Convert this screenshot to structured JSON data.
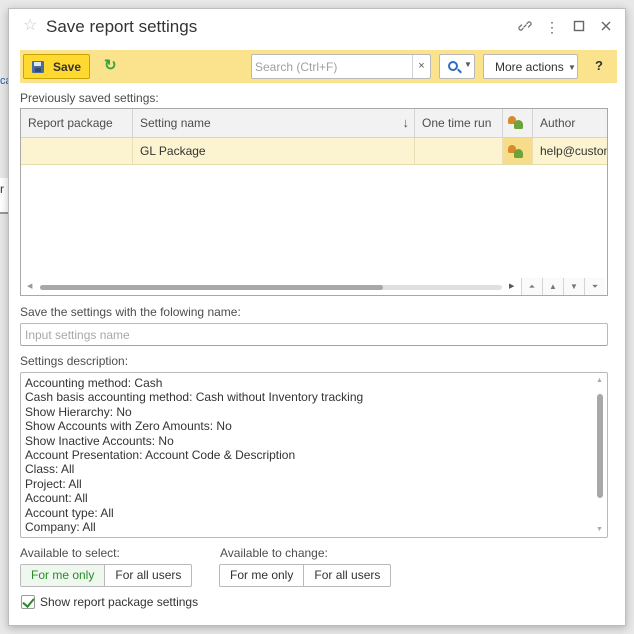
{
  "background": {
    "fragment_a": "ca",
    "fragment_b": "r"
  },
  "window": {
    "title": "Save report settings",
    "icons": [
      "star-icon",
      "link-icon",
      "more-vertical-icon",
      "maximize-icon",
      "close-icon"
    ]
  },
  "toolbar": {
    "save_label": "Save",
    "search_placeholder": "Search (Ctrl+F)",
    "search_clear": "×",
    "more_actions_label": "More actions",
    "help_label": "?"
  },
  "previously_saved": {
    "label": "Previously saved settings:",
    "columns": [
      "Report package",
      "Setting name",
      "One time run",
      "",
      "Author"
    ],
    "sort_indicator": "↓",
    "rows": [
      {
        "report_package": "",
        "setting_name": "GL Package",
        "one_time_run": "",
        "author": "help@customer"
      }
    ]
  },
  "name_field": {
    "label": "Save the settings with the folowing name:",
    "placeholder": "Input settings name",
    "value": ""
  },
  "description": {
    "label": "Settings description:",
    "lines": [
      "Accounting method: Cash",
      "Cash basis accounting method: Cash without Inventory tracking",
      "Show Hierarchy: No",
      "Show Accounts with Zero Amounts: No",
      "Show Inactive Accounts: No",
      "Account Presentation: Account Code & Description",
      "Class:  All",
      "Project:  All",
      "Account:  All",
      "Account type:  All",
      "Company:  All"
    ]
  },
  "available_to_select": {
    "label": "Available to select:",
    "options": [
      "For me only",
      "For all users"
    ],
    "selected": "For me only"
  },
  "available_to_change": {
    "label": "Available to change:",
    "options": [
      "For me only",
      "For all users"
    ]
  },
  "show_package": {
    "label": "Show report package settings",
    "checked": true
  },
  "colors": {
    "toolbar_bg": "#fbe38e",
    "save_button": "#ffd92f",
    "selected_row": "#fcf4d0",
    "active_option": "#2a8a2a"
  }
}
